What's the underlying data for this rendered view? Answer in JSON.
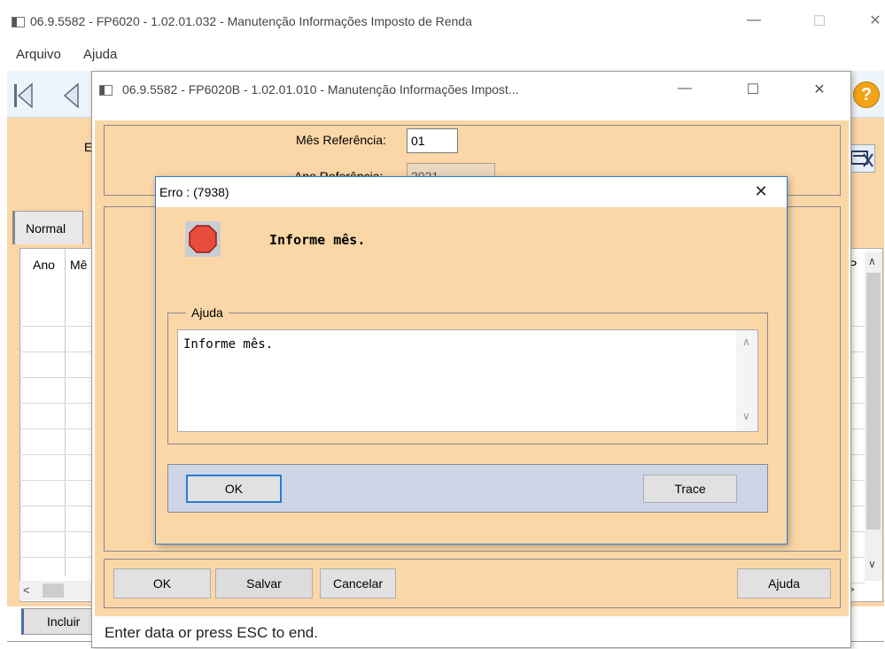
{
  "main_window": {
    "title": "06.9.5582 - FP6020 - 1.02.01.032 - Manutenção Informações Imposto de Renda",
    "menu": [
      "Arquivo",
      "Ajuda"
    ],
    "tab_label": "Normal",
    "table_headers": [
      "Ano",
      "Mê",
      "P"
    ],
    "partial_label": "E",
    "include_button": "Incluir",
    "help_glyph": "?"
  },
  "sub_window": {
    "title": "06.9.5582 - FP6020B - 1.02.01.010 - Manutenção Informações Impost...",
    "month_label": "Mês Referência:",
    "month_value": "01",
    "year_label": "Ano Referência:",
    "year_value": "2021",
    "buttons": {
      "ok": "OK",
      "save": "Salvar",
      "cancel": "Cancelar",
      "help": "Ajuda"
    },
    "status": "Enter data or press ESC to end."
  },
  "error_dialog": {
    "title": "Erro : (7938)",
    "message": "Informe mês.",
    "help_group_label": "Ajuda",
    "help_text": "Informe mês.",
    "ok_label": "OK",
    "trace_label": "Trace"
  },
  "colors": {
    "peach": "#fbd7a8",
    "dialog_blue_border": "#2b7cd3",
    "button_bar": "#cdd6e7",
    "stop_red": "#e74c3c"
  }
}
